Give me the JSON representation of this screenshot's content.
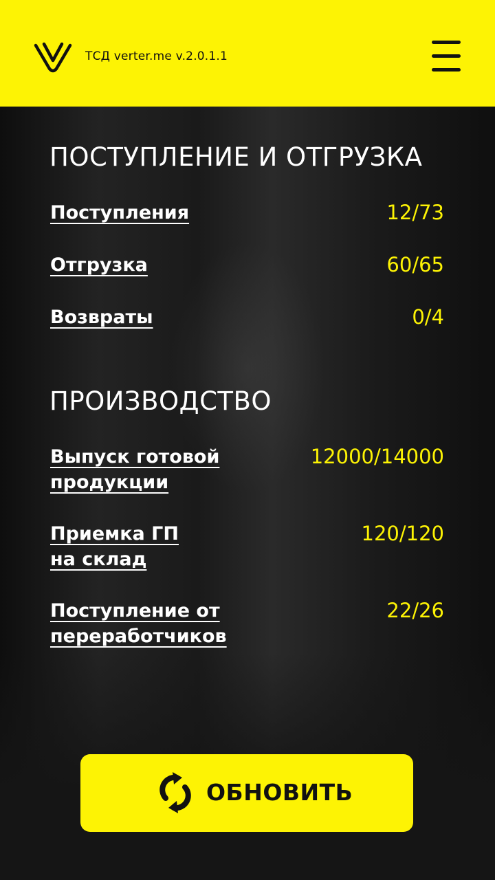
{
  "header": {
    "app_title": "ТСД verter.me v.2.0.1.1",
    "logo_icon": "verter-logo-icon",
    "menu_icon": "hamburger-menu-icon",
    "background_color": "#fdf304"
  },
  "sections": [
    {
      "title": "ПОСТУПЛЕНИЕ И ОТГРУЗКА",
      "rows": [
        {
          "label": "Поступления",
          "value": "12/73"
        },
        {
          "label": "Отгрузка",
          "value": "60/65"
        },
        {
          "label": "Возвраты",
          "value": "0/4"
        }
      ]
    },
    {
      "title": "ПРОИЗВОДСТВО",
      "rows": [
        {
          "label_line1": "Выпуск готовой",
          "label_line2": "продукции",
          "value": "12000/14000"
        },
        {
          "label_line1": "Приемка ГП",
          "label_line2": "на склад",
          "value": "120/120"
        },
        {
          "label_line1": "Поступление от",
          "label_line2": "переработчиков",
          "value": "22/26"
        }
      ]
    }
  ],
  "refresh_button": {
    "label": "ОБНОВИТЬ",
    "icon": "refresh-icon"
  },
  "colors": {
    "accent": "#fdf304",
    "text": "#ffffff",
    "background": "#141414"
  }
}
